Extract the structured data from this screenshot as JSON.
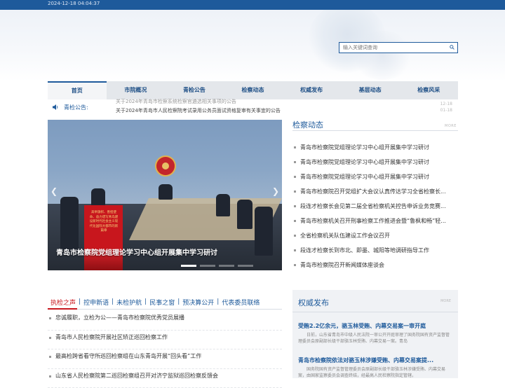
{
  "header": {
    "datetime": "2024-12-18 04:04:37"
  },
  "search": {
    "placeholder": "输入关键词查询",
    "icon": "search-icon"
  },
  "nav": [
    {
      "label": "首页"
    },
    {
      "label": "市院概况"
    },
    {
      "label": "青检公告"
    },
    {
      "label": "检察动态"
    },
    {
      "label": "权威发布"
    },
    {
      "label": "基层动态"
    },
    {
      "label": "检察风采"
    }
  ],
  "notice": {
    "label": "青检公告:",
    "items": [
      {
        "text": "关于2024年青岛市检察系统检察官遴选相关事项的公告",
        "date": "12-18"
      },
      {
        "text": "关于2024年青岛市人民检察院考试录用公务员面试资格复审有关事宜的公告",
        "date": "01-18"
      }
    ]
  },
  "slider": {
    "caption": "青岛市检察院党组理论学习中心组开展集中学习研讨",
    "poster_text": "高举旗帜、善担使命、奋力谱写青岛建设新时代社会主义现代化国际大都市的新篇章"
  },
  "jcdt": {
    "title": "检察动态",
    "more": "MORE",
    "items": [
      "青岛市检察院党组理论学习中心组开展集中学习研讨",
      "青岛市检察院党组理论学习中心组开展集中学习研讨",
      "青岛市检察院党组理论学习中心组开展集中学习研讨",
      "青岛市检察院召开党组扩大会议认真传达学习全省检察长...",
      "段连才检察长会见第二届全省检察机关控告申诉业务竞赛...",
      "青岛市检察机关召开刑事检察工作推进会暨“鲁枫和畅”轻...",
      "全省检察机关队伍建设工作会议召开",
      "段连才检察长到市北、即墨、城阳等地调研指导工作",
      "青岛市检察院召开新闻媒体座谈会"
    ]
  },
  "tabs": [
    {
      "label": "执检之声"
    },
    {
      "label": "控申新语"
    },
    {
      "label": "未检护航"
    },
    {
      "label": "民事之窗"
    },
    {
      "label": "预决算公开"
    },
    {
      "label": "代表委员联络"
    }
  ],
  "tab_items": [
    "忠诚履职，立检为公——青岛市检察院优秀党员展播",
    "青岛市人民检察院开展社区矫正巡回检察工作",
    "最高检跨省看守所巡回检察组在山东青岛开展“回头看”工作",
    "山东省人民检察院第二巡回检察组召开对济宁监狱巡回检察反馈会"
  ],
  "authority": {
    "title": "权威发布",
    "more": "MORE",
    "items": [
      {
        "headline": "受贿2.2亿余元，骆玉林受贿、内幕交易案一审开庭",
        "summary": "日前，山东省青岛市中级人民法院一审公开开庭审理了国务院国有资产监督管理委员会原副部长级干部骆玉林受贿、内幕交易一案。青岛"
      },
      {
        "headline": "青岛市检察院依法对骆玉林涉嫌受贿、内幕交易案提...",
        "summary": "国务院国有资产监督管理委员会原副部长级干部骆玉林涉嫌受贿、内幕交易案，由国家监察委员会调查终结，经最高人民检察院指定管辖，"
      }
    ]
  }
}
